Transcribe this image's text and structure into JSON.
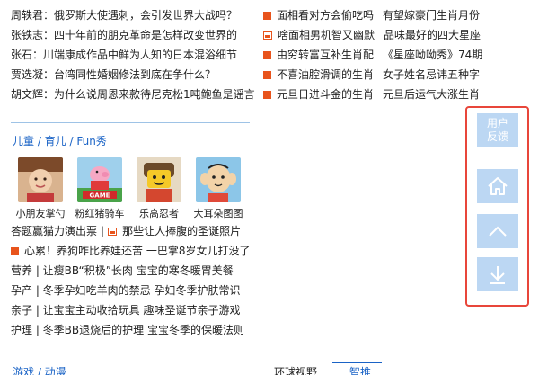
{
  "left_news": [
    {
      "author": "周轶君：",
      "title": "俄罗斯大使遇刺，会引发世界大战吗？"
    },
    {
      "author": "张铁志：",
      "title": "四十年前的朋克革命是怎样改变世界的"
    },
    {
      "author": "张石：",
      "title": "川端康成作品中鲜为人知的日本混浴细节"
    },
    {
      "author": "贾选凝：",
      "title": "台湾同性婚姻修法到底在争什么？"
    },
    {
      "author": "胡文辉：",
      "title": "为什么说周恩来款待尼克松1吨鲍鱼是谣言"
    }
  ],
  "right_news": [
    {
      "icon": "square-bullet-icon",
      "t1": "面相看对方会偷吃吗",
      "t2": "有望嫁豪门生肖月份"
    },
    {
      "icon": "picture-icon",
      "t1": "啥面相男机智又幽默",
      "t2": "品味最好的四大星座"
    },
    {
      "icon": "square-bullet-icon",
      "t1": "由穷转富互补生肖配",
      "t2": "《星座呦呦秀》74期"
    },
    {
      "icon": "square-bullet-icon",
      "t1": "不喜油腔滑调的生肖",
      "t2": "女子姓名忌讳五种字"
    },
    {
      "icon": "square-bullet-icon",
      "t1": "元旦日进斗金的生肖",
      "t2": "元旦后运气大涨生肖"
    }
  ],
  "kids_section": {
    "title": "儿童 / 育儿 / Fun秀",
    "items": [
      {
        "caption": "小朋友掌勺"
      },
      {
        "caption": "粉红猪骑车"
      },
      {
        "caption": "乐高忍者"
      },
      {
        "caption": "大耳朵图图"
      }
    ],
    "links": [
      {
        "icon": "",
        "text": "答题赢猫力演出票"
      },
      {
        "icon": "square-bullet-icon",
        "text": "心累！养狗咋比养娃还苦 一巴掌8岁女儿打没了"
      },
      {
        "icon": "",
        "text": "营养 | 让瘦BB“积极”长肉 宝宝的寒冬暖胃美餐"
      },
      {
        "icon": "",
        "text": "孕产 | 冬季孕妇吃羊肉的禁忌 孕妇冬季护肤常识"
      },
      {
        "icon": "",
        "text": "亲子 | 让宝宝主动收拾玩具 趣味圣诞节亲子游戏"
      },
      {
        "icon": "",
        "text": "护理 | 冬季BB退烧后的护理 宝宝冬季的保暖法则"
      }
    ],
    "inline_link": "那些让人捧腹的圣诞照片"
  },
  "bottom": {
    "left_title": "游戏 / 动漫",
    "tab_a": "环球视野",
    "tab_b": "智推"
  },
  "float_panel": {
    "feedback_line1": "用户",
    "feedback_line2": "反馈"
  },
  "colors": {
    "accent": "#e8541c",
    "link_blue": "#1a63c6",
    "float_btn": "#bcd7f3",
    "highlight_border": "#e8463a"
  }
}
